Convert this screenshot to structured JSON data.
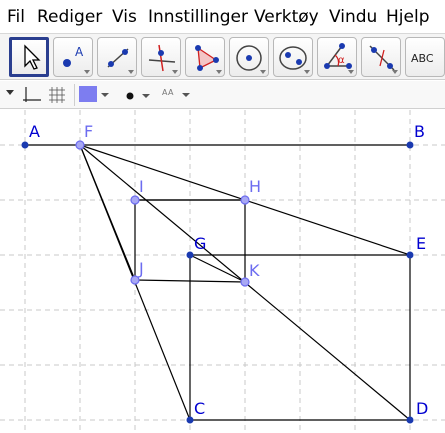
{
  "menu": {
    "items": [
      "Fil",
      "Rediger",
      "Vis",
      "Innstillinger",
      "Verktøy",
      "Vindu",
      "Hjelp"
    ]
  },
  "toolbar": {
    "tools": [
      {
        "name": "move-tool",
        "icon": "cursor-arrow-icon",
        "active": true
      },
      {
        "name": "point-tool",
        "icon": "point-icon",
        "label": "A"
      },
      {
        "name": "line-tool",
        "icon": "line-icon"
      },
      {
        "name": "perpendicular-line-tool",
        "icon": "perpendicular-icon"
      },
      {
        "name": "polygon-tool",
        "icon": "triangle-icon"
      },
      {
        "name": "circle-tool",
        "icon": "circle-center-icon"
      },
      {
        "name": "ellipse-tool",
        "icon": "ellipse-icon"
      },
      {
        "name": "angle-tool",
        "icon": "angle-icon",
        "label": "α"
      },
      {
        "name": "reflect-tool",
        "icon": "reflect-line-icon"
      },
      {
        "name": "text-tool",
        "icon": "text-icon",
        "label": "ABC"
      }
    ]
  },
  "stylebar": {
    "color": "#7d7df0",
    "text_size_label": "A A"
  },
  "colors": {
    "point_blue": "#1a3ab0",
    "point_free": "#6c6cf0",
    "label_free": "#6c6cf0",
    "label_fixed": "#0000d0",
    "grid": "#c8c8c8"
  },
  "points": [
    {
      "id": "A",
      "label": "A",
      "free": false
    },
    {
      "id": "B",
      "label": "B",
      "free": false
    },
    {
      "id": "F",
      "label": "F",
      "free": true
    },
    {
      "id": "I",
      "label": "I",
      "free": true
    },
    {
      "id": "H",
      "label": "H",
      "free": true
    },
    {
      "id": "G",
      "label": "G",
      "free": false
    },
    {
      "id": "E",
      "label": "E",
      "free": false
    },
    {
      "id": "J",
      "label": "J",
      "free": true
    },
    {
      "id": "K",
      "label": "K",
      "free": true
    },
    {
      "id": "C",
      "label": "C",
      "free": false
    },
    {
      "id": "D",
      "label": "D",
      "free": false
    }
  ]
}
